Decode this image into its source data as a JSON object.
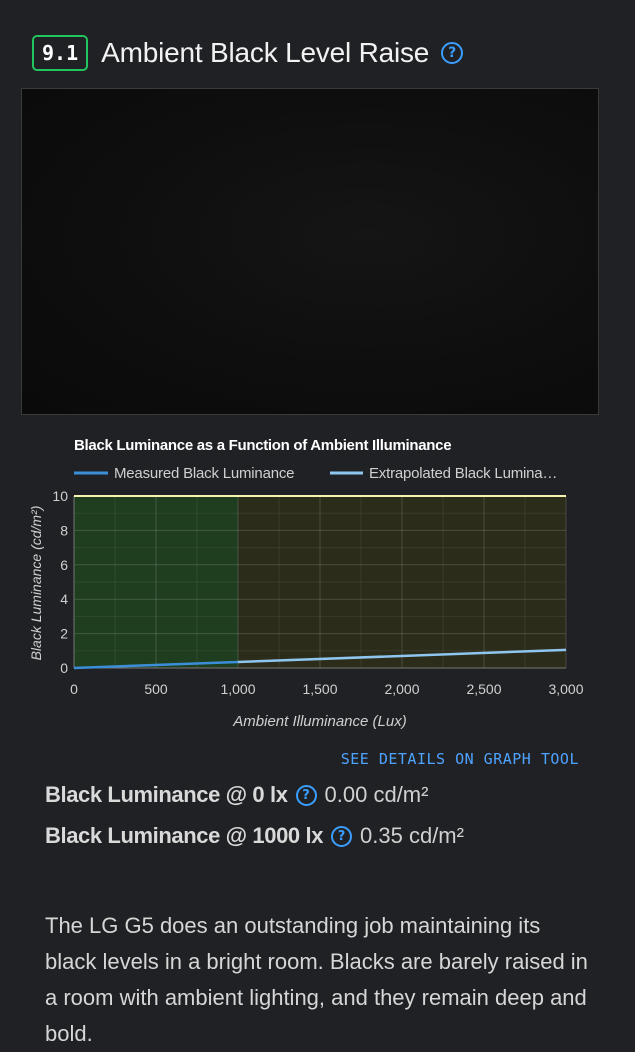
{
  "section": {
    "number": "9.1",
    "title": "Ambient Black Level Raise",
    "help_glyph": "?"
  },
  "chart_data": {
    "type": "line",
    "title": "Black Luminance as a Function of Ambient Illuminance",
    "xlabel": "Ambient Illuminance (Lux)",
    "ylabel": "Black Luminance (cd/m²)",
    "xlim": [
      0,
      3000
    ],
    "ylim": [
      0,
      10
    ],
    "x_ticks": [
      0,
      500,
      1000,
      1500,
      2000,
      2500,
      3000
    ],
    "x_tick_labels": [
      "0",
      "500",
      "1,000",
      "1,500",
      "2,000",
      "2,500",
      "3,000"
    ],
    "y_ticks": [
      0,
      2,
      4,
      6,
      8,
      10
    ],
    "y_tick_labels": [
      "0",
      "2",
      "4",
      "6",
      "8",
      "10"
    ],
    "grid": true,
    "legend_position": "top",
    "legend_entries": [
      "Measured Black Luminance",
      "Extrapolated Black Lumina…"
    ],
    "regions": [
      {
        "x_from": 0,
        "x_to": 1000,
        "color": "#1f3d1f"
      },
      {
        "x_from": 1000,
        "x_to": 3000,
        "color": "#2c2c1a"
      }
    ],
    "threshold_line": {
      "y": 10,
      "color": "#f5f5b0"
    },
    "series": [
      {
        "name": "Measured Black Luminance",
        "color": "#3b8fd9",
        "x": [
          0,
          1000
        ],
        "y": [
          0.0,
          0.35
        ]
      },
      {
        "name": "Extrapolated Black Lumina…",
        "color": "#8fc6ef",
        "x": [
          1000,
          3000
        ],
        "y": [
          0.35,
          1.05
        ]
      }
    ]
  },
  "details_link": "SEE DETAILS ON GRAPH TOOL",
  "metrics": [
    {
      "label": "Black Luminance @ 0 lx",
      "value": "0.00 cd/m²"
    },
    {
      "label": "Black Luminance @ 1000 lx",
      "value": "0.35 cd/m²"
    }
  ],
  "description": "The LG G5 does an outstanding job maintaining its black levels in a bright room. Blacks are barely raised in a room with ambient lighting, and they remain deep and bold."
}
